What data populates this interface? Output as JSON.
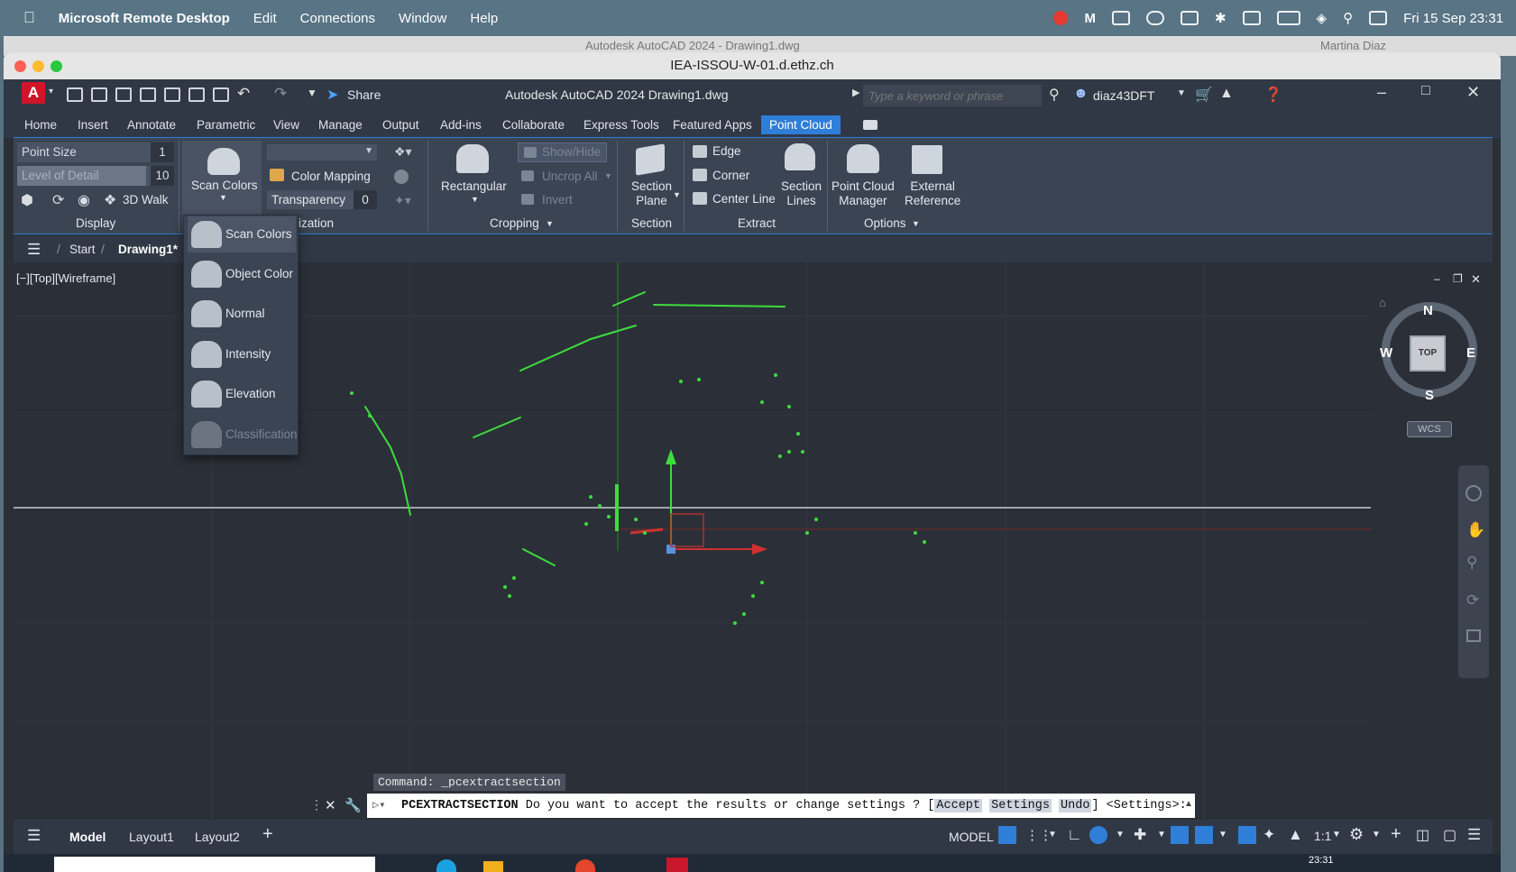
{
  "mac_menubar": {
    "app": "Microsoft Remote Desktop",
    "items": [
      "Edit",
      "Connections",
      "Window",
      "Help"
    ],
    "clock": "Fri 15 Sep  23:31"
  },
  "background_window": {
    "title": "Autodesk AutoCAD 2024 - Drawing1.dwg",
    "user": "Martina Diaz"
  },
  "rdp": {
    "title": "IEA-ISSOU-W-01.d.ethz.ch"
  },
  "acad": {
    "logo": "A",
    "share": "Share",
    "doc_title": "Autodesk AutoCAD 2024   Drawing1.dwg",
    "search_placeholder": "Type a keyword or phrase",
    "user": "diaz43DFT"
  },
  "ribbon_tabs": [
    "Home",
    "Insert",
    "Annotate",
    "Parametric",
    "View",
    "Manage",
    "Output",
    "Add-ins",
    "Collaborate",
    "Express Tools",
    "Featured Apps",
    "Point Cloud"
  ],
  "ribbon": {
    "display": {
      "title": "Display",
      "point_size_label": "Point Size",
      "point_size_value": "1",
      "lod_label": "Level of Detail",
      "lod_value": "10",
      "walk": "3D Walk"
    },
    "visualization": {
      "title": "ization",
      "scan_colors": "Scan Colors",
      "color_mapping": "Color Mapping",
      "transparency_label": "Transparency",
      "transparency_value": "0"
    },
    "cropping": {
      "title": "Cropping",
      "rectangular": "Rectangular",
      "show_hide": "Show/Hide",
      "uncrop_all": "Uncrop All",
      "invert": "Invert"
    },
    "section": {
      "title": "Section",
      "plane_l1": "Section",
      "plane_l2": "Plane"
    },
    "extract": {
      "title": "Extract",
      "edge": "Edge",
      "corner": "Corner",
      "center_line": "Center Line",
      "lines_l1": "Section",
      "lines_l2": "Lines"
    },
    "options": {
      "title": "Options",
      "manager_l1": "Point Cloud",
      "manager_l2": "Manager",
      "xref_l1": "External",
      "xref_l2": "Reference"
    }
  },
  "scan_dropdown": [
    "Scan Colors",
    "Object Color",
    "Normal",
    "Intensity",
    "Elevation",
    "Classification"
  ],
  "file_tabs": {
    "start": "Start",
    "drawing": "Drawing1*"
  },
  "viewport": {
    "label": "[−][Top][Wireframe]"
  },
  "viewcube": {
    "n": "N",
    "s": "S",
    "e": "E",
    "w": "W",
    "face": "TOP",
    "wcs": "WCS"
  },
  "command": {
    "history": "Command: _pcextractsection",
    "name": "PCEXTRACTSECTION",
    "prompt": " Do you want to accept the results or change settings ? [",
    "opt_accept": "Accept",
    "opt_settings": "Settings",
    "opt_undo": "Undo",
    "suffix": "] <Settings>:"
  },
  "status": {
    "model_tab": "Model",
    "layout1": "Layout1",
    "layout2": "Layout2",
    "add": "+",
    "mode": "MODEL",
    "scale": "1:1"
  },
  "taskbar": {
    "time": "23:31"
  },
  "colors": {
    "accent": "#2f7ed8",
    "points": "#3ddc3d",
    "bg": "#2b3038"
  }
}
